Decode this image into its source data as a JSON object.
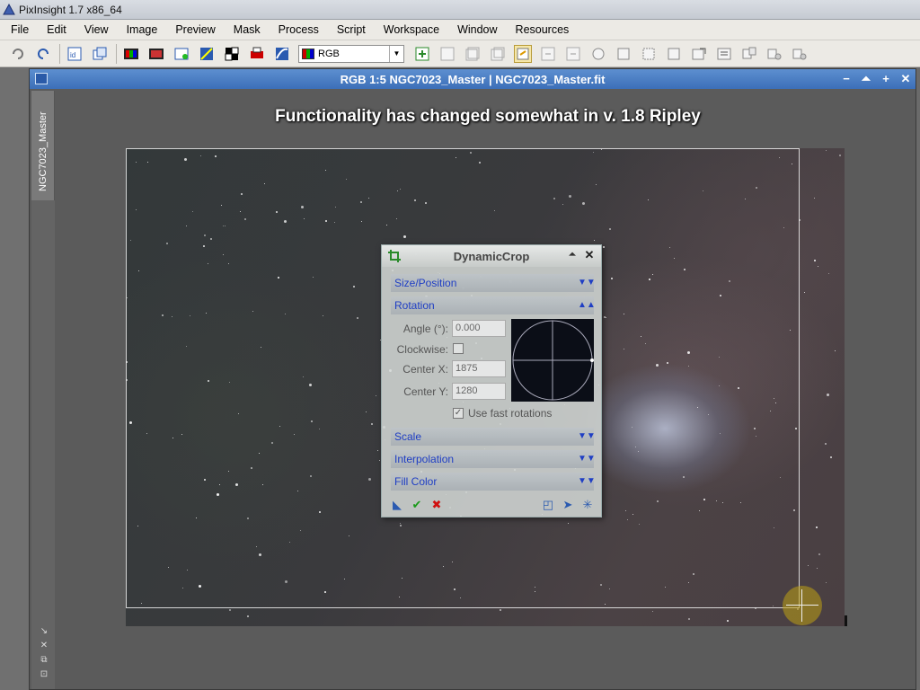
{
  "app": {
    "title": "PixInsight 1.7 x86_64"
  },
  "menu": [
    "File",
    "Edit",
    "View",
    "Image",
    "Preview",
    "Mask",
    "Process",
    "Script",
    "Workspace",
    "Window",
    "Resources"
  ],
  "toolbar": {
    "channel_select": "RGB"
  },
  "image_window": {
    "title": "RGB 1:5 NGC7023_Master | NGC7023_Master.fit",
    "side_tab": "NGC7023_Master"
  },
  "caption": "Functionality has changed somewhat in v. 1.8 Ripley",
  "dynamic_crop": {
    "title": "DynamicCrop",
    "sections": {
      "size_position": "Size/Position",
      "rotation": "Rotation",
      "scale": "Scale",
      "interpolation": "Interpolation",
      "fill_color": "Fill Color"
    },
    "rotation": {
      "angle_label": "Angle (°):",
      "angle_value": "0.000",
      "clockwise_label": "Clockwise:",
      "center_x_label": "Center X:",
      "center_x_value": "1875",
      "center_y_label": "Center Y:",
      "center_y_value": "1280",
      "fast_rotations_label": "Use fast rotations"
    }
  },
  "colors": {
    "title_blue": "#3c6fb8",
    "section_text": "#1f3ec4",
    "crop_handle": "#bea014"
  }
}
